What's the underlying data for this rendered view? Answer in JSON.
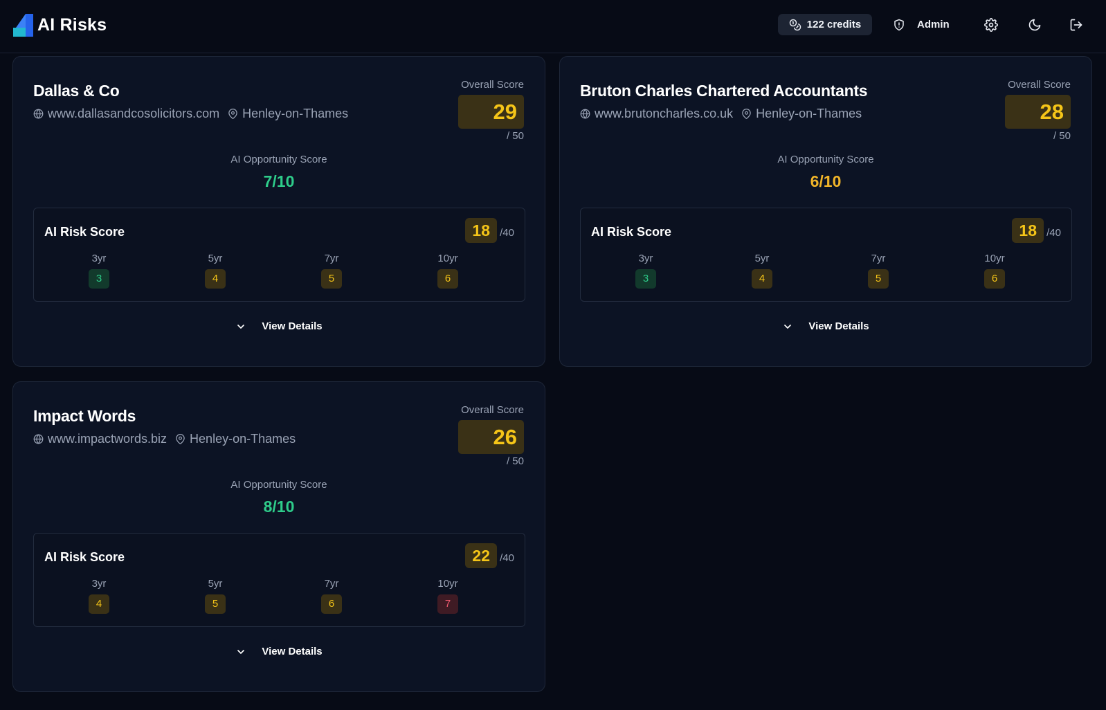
{
  "app": {
    "title": "AI Risks"
  },
  "header": {
    "credits_label": "122 credits",
    "user_label": "Admin"
  },
  "labels": {
    "overall_score": "Overall Score",
    "overall_max": "/ 50",
    "opportunity": "AI Opportunity Score",
    "risk_title": "AI Risk Score",
    "risk_max": "/40",
    "view_details": "View Details"
  },
  "horizons": [
    "3yr",
    "5yr",
    "7yr",
    "10yr"
  ],
  "cards": [
    {
      "name": "Dallas & Co",
      "website": "www.dallasandcosolicitors.com",
      "location": "Henley-on-Thames",
      "overall_score": "29",
      "opportunity_score": "7/10",
      "risk_score": "18",
      "horizon_values": [
        "3",
        "4",
        "5",
        "6"
      ]
    },
    {
      "name": "Bruton Charles Chartered Accountants",
      "website": "www.brutoncharles.co.uk",
      "location": "Henley-on-Thames",
      "overall_score": "28",
      "opportunity_score": "6/10",
      "risk_score": "18",
      "horizon_values": [
        "3",
        "4",
        "5",
        "6"
      ]
    },
    {
      "name": "Impact Words",
      "website": "www.impactwords.biz",
      "location": "Henley-on-Thames",
      "overall_score": "26",
      "opportunity_score": "8/10",
      "risk_score": "22",
      "horizon_values": [
        "4",
        "5",
        "6",
        "7"
      ]
    }
  ],
  "colors": {
    "background": "#070b16",
    "card": "#0c1324",
    "score_amber": "#f5c518",
    "score_green": "#2ecc8a",
    "score_red": "#ef5a6f",
    "brand_blue": "#2563eb",
    "brand_cyan": "#22b8cf"
  },
  "icons": {
    "credits": "coins-icon",
    "admin": "shield-icon",
    "settings": "gear-icon",
    "theme": "moon-icon",
    "logout": "logout-icon",
    "website": "globe-icon",
    "location": "map-pin-icon",
    "expand": "chevron-down-icon"
  }
}
